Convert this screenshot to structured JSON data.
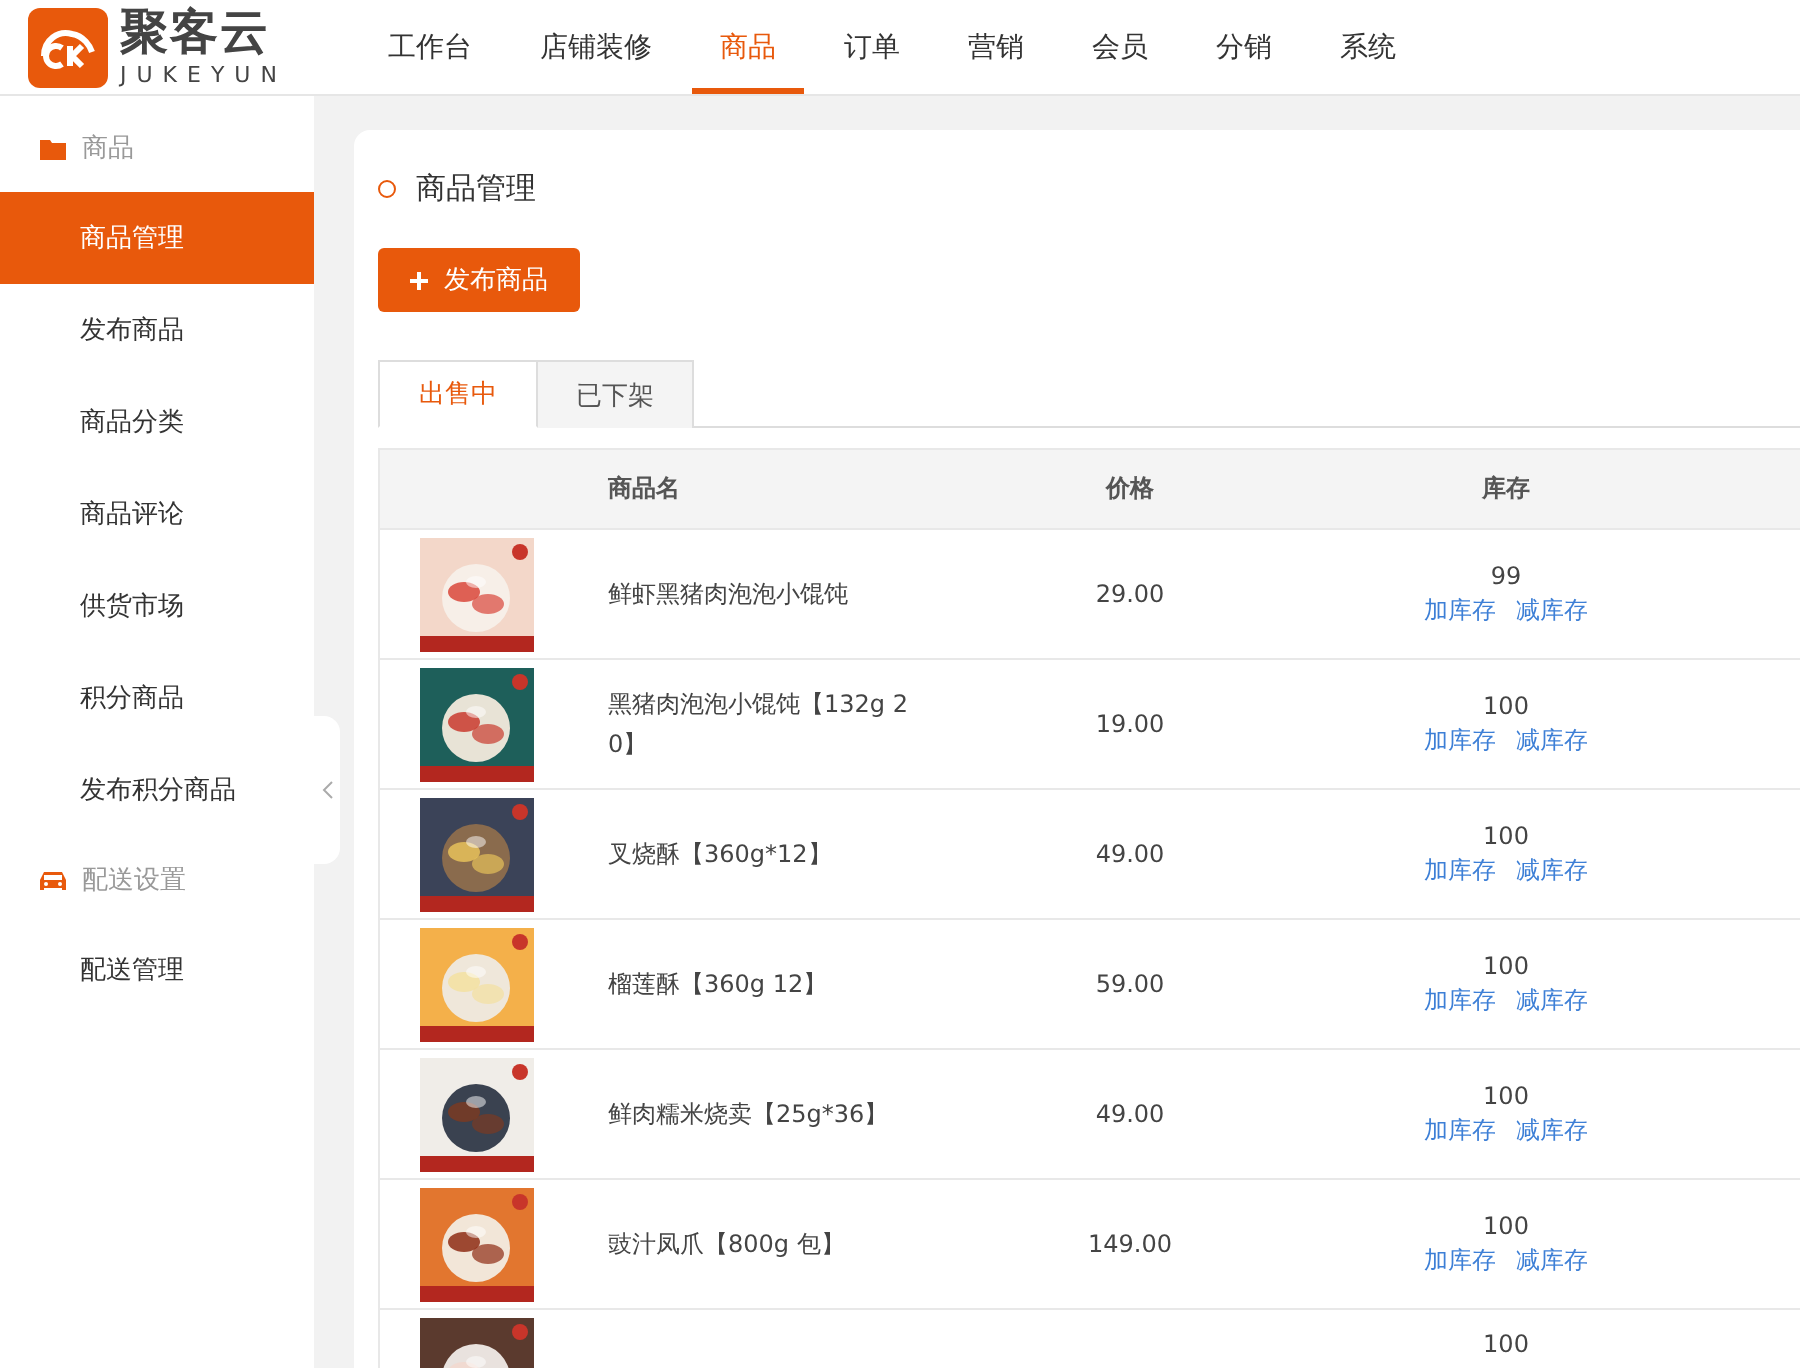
{
  "logo": {
    "name": "聚客云",
    "subtitle": "JUKEYUN"
  },
  "nav": [
    {
      "label": "工作台",
      "selected": false
    },
    {
      "label": "店铺装修",
      "selected": false
    },
    {
      "label": "商品",
      "selected": true
    },
    {
      "label": "订单",
      "selected": false
    },
    {
      "label": "营销",
      "selected": false
    },
    {
      "label": "会员",
      "selected": false
    },
    {
      "label": "分销",
      "selected": false
    },
    {
      "label": "系统",
      "selected": false
    }
  ],
  "sidebar": {
    "groups": [
      {
        "title": "商品",
        "kind": "folder",
        "items": [
          {
            "label": "商品管理",
            "selected": true
          },
          {
            "label": "发布商品",
            "selected": false
          },
          {
            "label": "商品分类",
            "selected": false
          },
          {
            "label": "商品评论",
            "selected": false
          },
          {
            "label": "供货市场",
            "selected": false
          },
          {
            "label": "积分商品",
            "selected": false
          },
          {
            "label": "发布积分商品",
            "selected": false
          }
        ]
      },
      {
        "title": "配送设置",
        "kind": "car",
        "items": [
          {
            "label": "配送管理",
            "selected": false
          }
        ]
      }
    ]
  },
  "page": {
    "title": "商品管理",
    "publish_button": "发布商品"
  },
  "tabs": [
    {
      "label": "出售中",
      "selected": true
    },
    {
      "label": "已下架",
      "selected": false
    }
  ],
  "table": {
    "columns": [
      "商品名",
      "价格",
      "库存"
    ],
    "rows": [
      {
        "name": "鲜虾黑猪肉泡泡小馄饨",
        "price": "29.00",
        "stock": "99",
        "add": "加库存",
        "reduce": "减库存"
      },
      {
        "name": "黑猪肉泡泡小馄饨【132g 20】",
        "price": "19.00",
        "stock": "100",
        "add": "加库存",
        "reduce": "减库存"
      },
      {
        "name": "叉烧酥【360g*12】",
        "price": "49.00",
        "stock": "100",
        "add": "加库存",
        "reduce": "减库存"
      },
      {
        "name": "榴莲酥【360g 12】",
        "price": "59.00",
        "stock": "100",
        "add": "加库存",
        "reduce": "减库存"
      },
      {
        "name": "鲜肉糯米烧卖【25g*36】",
        "price": "49.00",
        "stock": "100",
        "add": "加库存",
        "reduce": "减库存"
      },
      {
        "name": "豉汁凤爪【800g 包】",
        "price": "149.00",
        "stock": "100",
        "add": "加库存",
        "reduce": "减库存"
      },
      {
        "stock": "100"
      }
    ]
  }
}
